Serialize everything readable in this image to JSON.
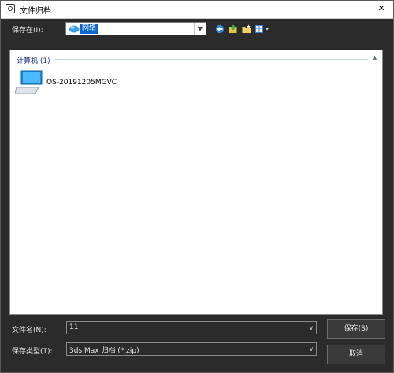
{
  "window": {
    "title": "文件归档",
    "close_glyph": "✕"
  },
  "location": {
    "label": "保存在(I):",
    "value": "网络",
    "icon": "network-icon"
  },
  "toolbar": {
    "icons": [
      "back-globe-icon",
      "up-folder-icon",
      "new-folder-icon",
      "view-menu-icon"
    ]
  },
  "list": {
    "group_header": "计算机 (1)",
    "items": [
      {
        "label": "OS-20191205MGVC",
        "icon": "computer-icon"
      }
    ]
  },
  "filename": {
    "label": "文件名(N):",
    "value": "11"
  },
  "filetype": {
    "label": "保存类型(T):",
    "value": "3ds Max 归档 (*.zip)"
  },
  "buttons": {
    "save": "保存(S)",
    "cancel": "取消"
  },
  "colors": {
    "selection": "#0a64d2",
    "group_header": "#1e3287",
    "dialog_bg": "#2b2b2b"
  }
}
